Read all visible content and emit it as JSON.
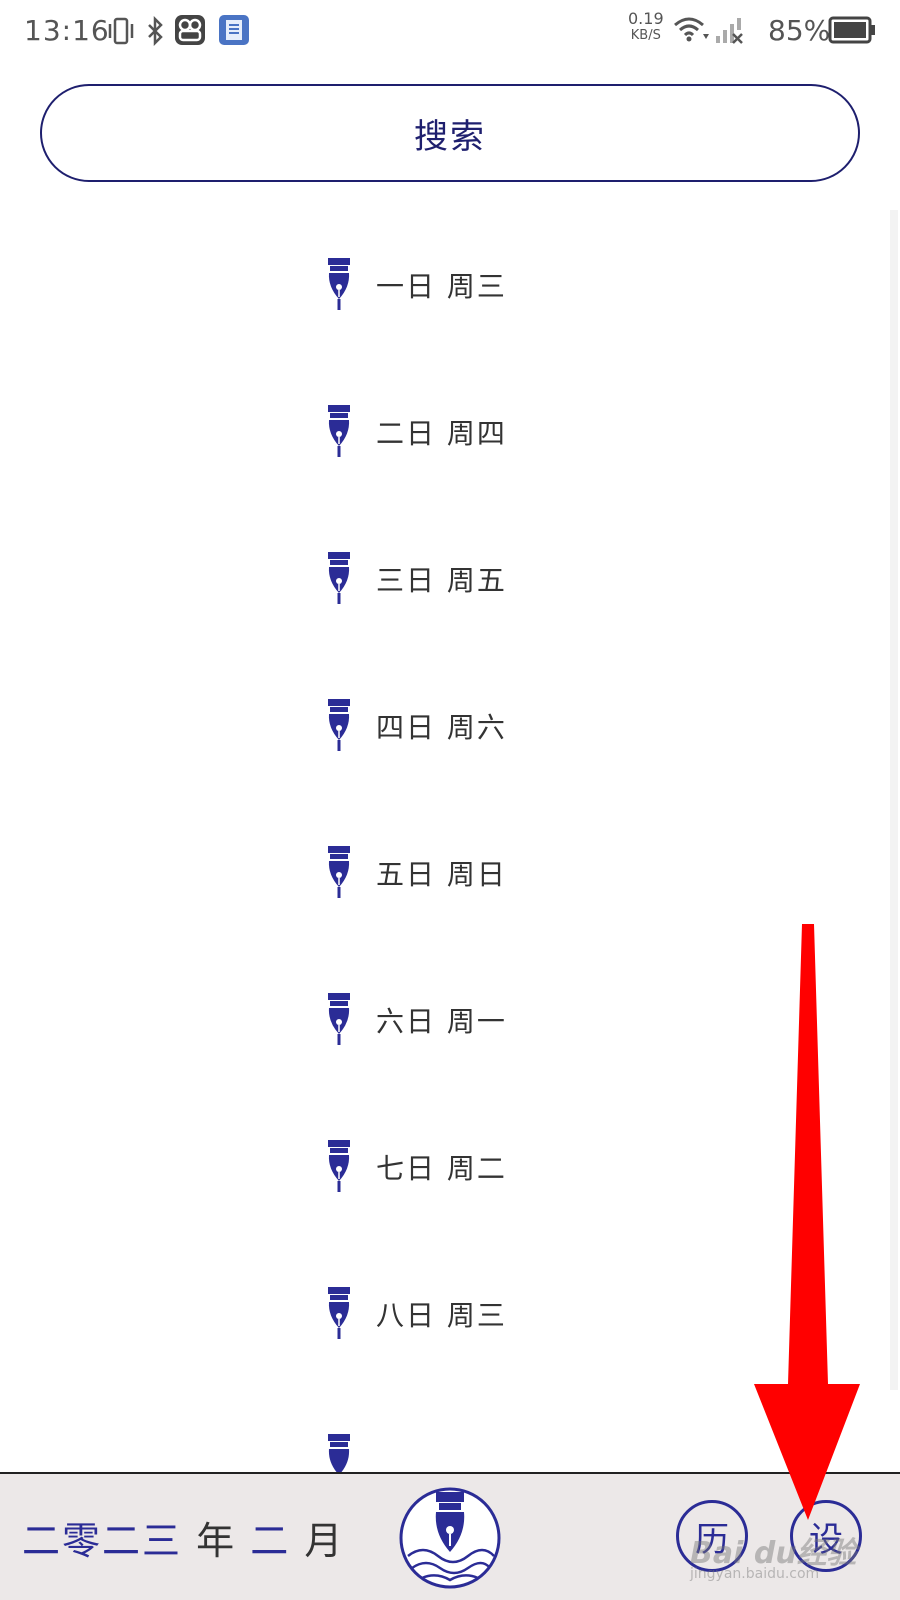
{
  "status_bar": {
    "time": "13:16",
    "net_speed_value": "0.19",
    "net_speed_unit": "KB/S",
    "battery": "85%"
  },
  "search": {
    "label": "搜索"
  },
  "days": [
    "一日 周三",
    "二日 周四",
    "三日 周五",
    "四日 周六",
    "五日 周日",
    "六日 周一",
    "七日 周二",
    "八日 周三"
  ],
  "bottom": {
    "date_part1": "二零二三",
    "date_year": "年",
    "date_part2": "二",
    "date_month": "月",
    "btn_left": "历",
    "btn_right": "设"
  },
  "watermark": {
    "main": "Bai du经验",
    "sub": "jingyan.baidu.com"
  },
  "colors": {
    "accent": "#2b2c96",
    "annotation_arrow": "#ff0000"
  }
}
